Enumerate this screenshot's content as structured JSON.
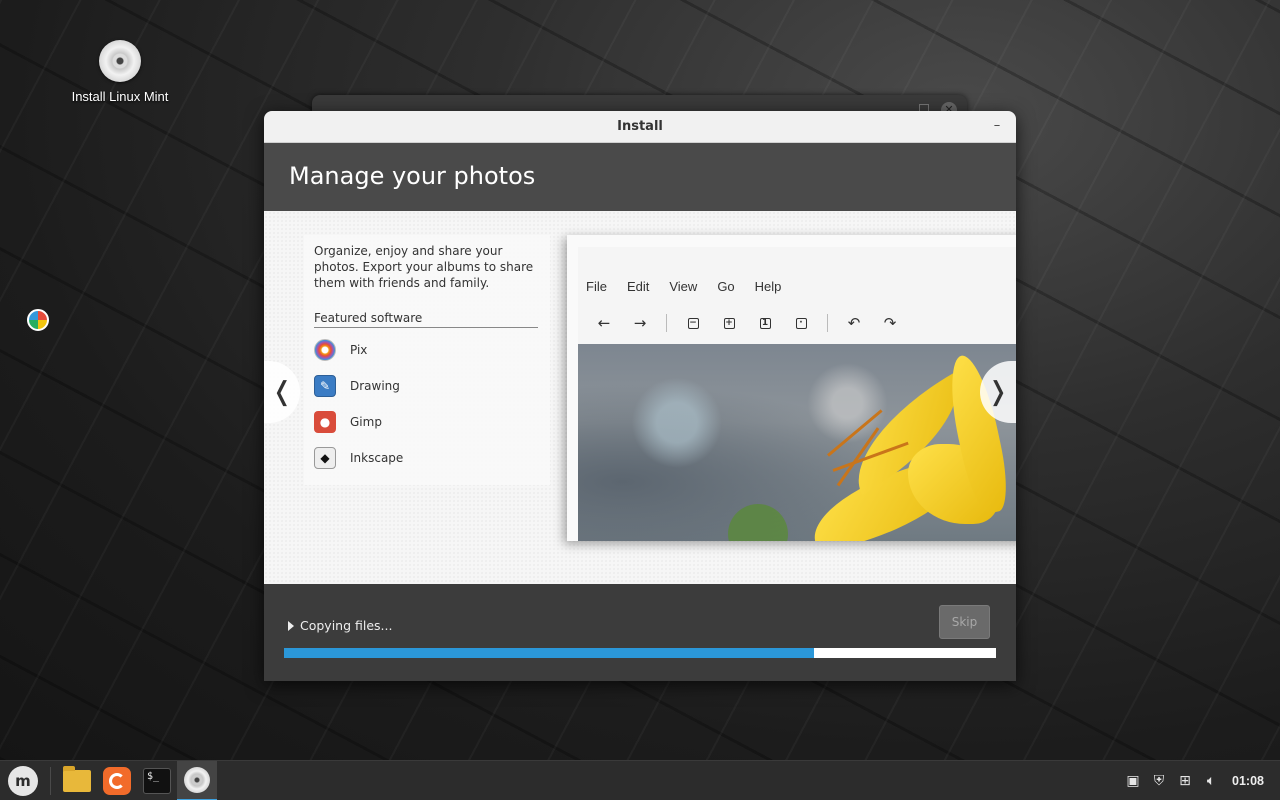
{
  "desktop": {
    "icons": [
      {
        "label": "Install Linux Mint"
      }
    ]
  },
  "install_window": {
    "title": "Install",
    "slide": {
      "title": "Manage your photos",
      "description": "Organize, enjoy and share your photos. Export your albums to share them with friends and family.",
      "featured_label": "Featured software",
      "software": [
        {
          "name": "Pix",
          "icon": "pix-icon"
        },
        {
          "name": "Drawing",
          "icon": "drawing-icon"
        },
        {
          "name": "Gimp",
          "icon": "gimp-icon"
        },
        {
          "name": "Inkscape",
          "icon": "inkscape-icon"
        }
      ],
      "screenshot_menu": [
        "File",
        "Edit",
        "View",
        "Go",
        "Help"
      ],
      "nav_prev_glyph": "❬",
      "nav_next_glyph": "❭"
    },
    "status": {
      "text": "Copying files...",
      "progress": 0.745
    },
    "skip_label": "Skip"
  },
  "taskbar": {
    "clock": "01:08"
  },
  "colors": {
    "progress": "#2b97d8",
    "header_bg": "#4a4a4a",
    "footer_bg": "#3c3c3c"
  }
}
